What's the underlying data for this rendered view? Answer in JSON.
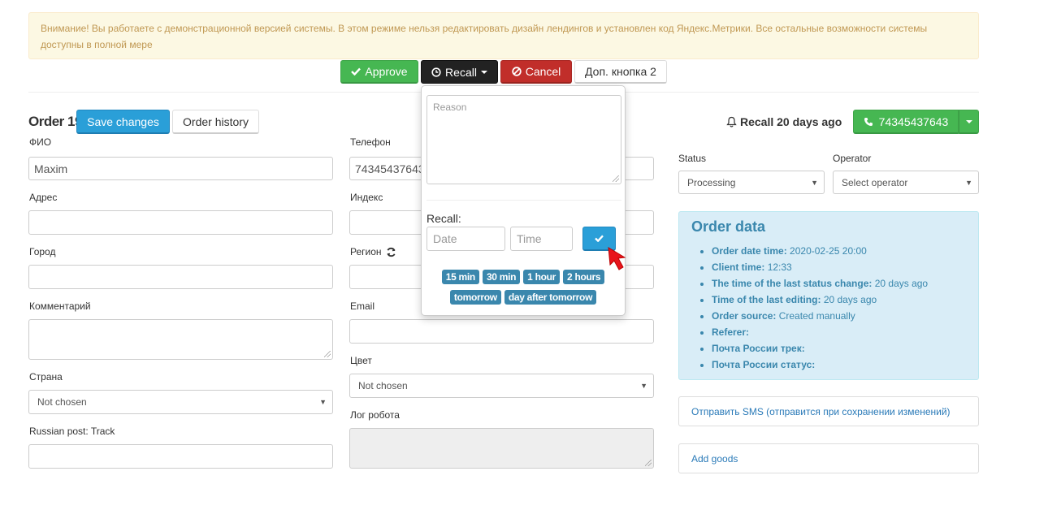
{
  "alert": {
    "text": "Внимание! Вы работаете с демонстрационной версией системы. В этом режиме нельзя редактировать дизайн лендингов и установлен код Яндекс.Метрики. Все остальные возможности системы доступны в полной мере"
  },
  "toolbar": {
    "approve_label": "Approve",
    "recall_label": "Recall",
    "cancel_label": "Cancel",
    "extra_label": "Доп. кнопка 2"
  },
  "recall_popover": {
    "reason_placeholder": "Reason",
    "recall_label": "Recall:",
    "date_placeholder": "Date",
    "time_placeholder": "Time",
    "quick_options_row1": [
      "15 min",
      "30 min",
      "1 hour",
      "2 hours"
    ],
    "quick_options_row2": [
      "tomorrow",
      "day after tomorrow"
    ]
  },
  "order": {
    "title": "Order 19",
    "save_label": "Save changes",
    "history_label": "Order history"
  },
  "form": {
    "fio": {
      "label": "ФИО",
      "value": "Maxim"
    },
    "address": {
      "label": "Адрес",
      "value": ""
    },
    "city": {
      "label": "Город",
      "value": ""
    },
    "comment": {
      "label": "Комментарий",
      "value": ""
    },
    "country": {
      "label": "Страна",
      "value": "Not chosen"
    },
    "track": {
      "label": "Russian post: Track",
      "value": ""
    },
    "phone": {
      "label": "Телефон",
      "value": "74345437643"
    },
    "index": {
      "label": "Индекс",
      "value": ""
    },
    "region": {
      "label": "Регион",
      "value": ""
    },
    "email": {
      "label": "Email",
      "value": ""
    },
    "color": {
      "label": "Цвет",
      "value": "Not chosen"
    },
    "robot_log": {
      "label": "Лог робота",
      "value": ""
    }
  },
  "right": {
    "recall_status": "Recall 20 days ago",
    "phone_button": "74345437643",
    "status": {
      "label": "Status",
      "value": "Processing"
    },
    "operator": {
      "label": "Operator",
      "value": "Select operator"
    },
    "order_data": {
      "title": "Order data",
      "items": [
        {
          "key": "Order date time:",
          "value": "2020-02-25 20:00"
        },
        {
          "key": "Client time:",
          "value": "12:33"
        },
        {
          "key": "The time of the last status change:",
          "value": "20 days ago"
        },
        {
          "key": "Time of the last editing:",
          "value": "20 days ago"
        },
        {
          "key": "Order source:",
          "value": "Created manually"
        },
        {
          "key": "Referer:",
          "value": ""
        },
        {
          "key": "Почта России трек:",
          "value": ""
        },
        {
          "key": "Почта России статус:",
          "value": ""
        }
      ]
    },
    "send_sms_label": "Отправить SMS (отправится при сохранении изменений)",
    "add_goods_label": "Add goods"
  },
  "colors": {
    "approve": "#46b752",
    "recall": "#222222",
    "cancel": "#c12e2a",
    "primary": "#2a9fd8",
    "info_bg": "#d9edf7",
    "info_text": "#3a87ad",
    "warning_bg": "#fcf8e3"
  }
}
